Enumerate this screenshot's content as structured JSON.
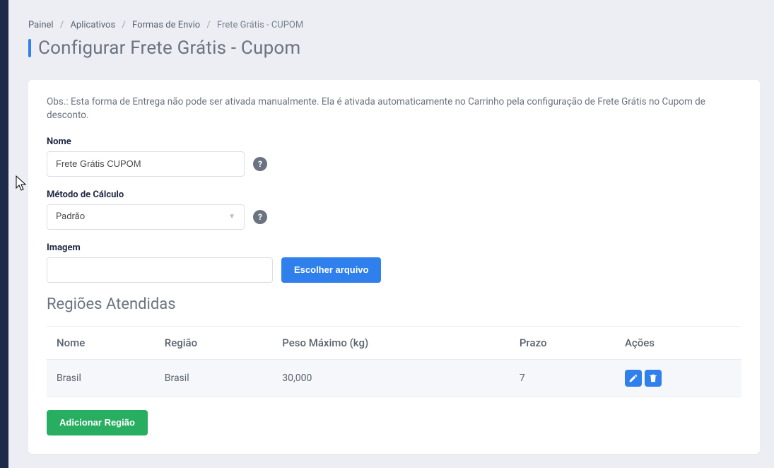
{
  "breadcrumb": {
    "items": [
      "Painel",
      "Aplicativos",
      "Formas de Envio"
    ],
    "current": "Frete Grátis - CUPOM"
  },
  "page_title": "Configurar Frete Grátis - Cupom",
  "note": "Obs.: Esta forma de Entrega não pode ser ativada manualmente. Ela é ativada automaticamente no Carrinho pela configuração de Frete Grátis no Cupom de desconto.",
  "form": {
    "nome_label": "Nome",
    "nome_value": "Frete Grátis CUPOM",
    "metodo_label": "Método de Cálculo",
    "metodo_selected": "Padrão",
    "imagem_label": "Imagem",
    "escolher_arquivo_btn": "Escolher arquivo",
    "help_glyph": "?"
  },
  "regions": {
    "title": "Regiões Atendidas",
    "columns": {
      "nome": "Nome",
      "regiao": "Região",
      "peso": "Peso Máximo (kg)",
      "prazo": "Prazo",
      "acoes": "Ações"
    },
    "rows": [
      {
        "nome": "Brasil",
        "regiao": "Brasil",
        "peso": "30,000",
        "prazo": "7"
      }
    ],
    "add_btn": "Adicionar Região"
  }
}
